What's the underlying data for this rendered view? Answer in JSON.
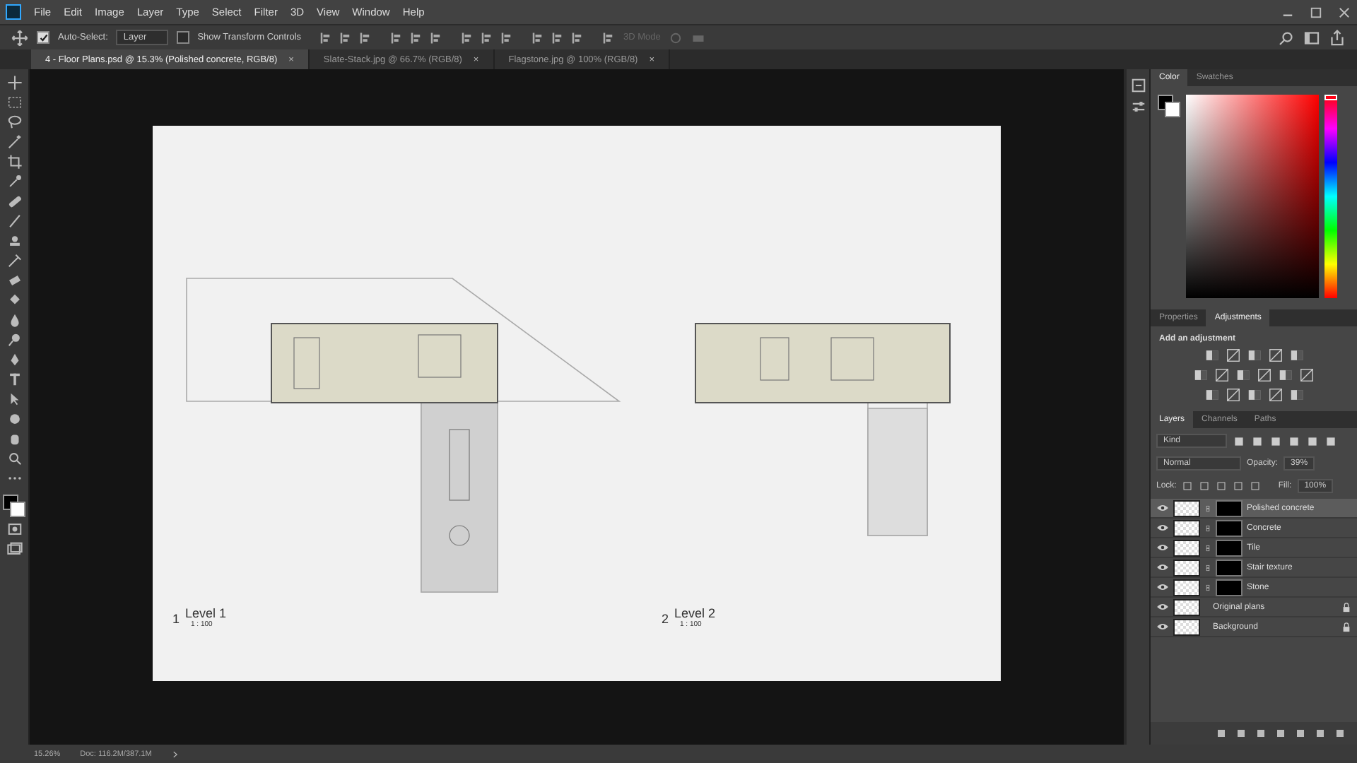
{
  "menu": [
    "File",
    "Edit",
    "Image",
    "Layer",
    "Type",
    "Select",
    "Filter",
    "3D",
    "View",
    "Window",
    "Help"
  ],
  "options_bar": {
    "auto_select": {
      "label": "Auto-Select:",
      "checked": true
    },
    "target": {
      "value": "Layer"
    },
    "transform_controls": {
      "label": "Show Transform Controls",
      "checked": false
    },
    "mode_3d": {
      "label": "3D Mode",
      "disabled": true
    }
  },
  "document_tabs": [
    {
      "label": "4 - Floor Plans.psd @ 15.3% (Polished concrete, RGB/8)",
      "close": "×",
      "selected": true
    },
    {
      "label": "Slate-Stack.jpg @ 66.7% (RGB/8)",
      "close": "×",
      "selected": false
    },
    {
      "label": "Flagstone.jpg @ 100% (RGB/8)",
      "close": "×",
      "selected": false
    }
  ],
  "canvas": {
    "plans": [
      {
        "number": "1",
        "title": "Level 1",
        "scale": "1 : 100"
      },
      {
        "number": "2",
        "title": "Level 2",
        "scale": "1 : 100"
      }
    ]
  },
  "color_panel": {
    "tabs": [
      {
        "label": "Color",
        "selected": true
      },
      {
        "label": "Swatches",
        "selected": false
      }
    ],
    "hue_slider": {
      "level": 1
    }
  },
  "adjustments_panel": {
    "tabs": [
      {
        "label": "Properties",
        "selected": false
      },
      {
        "label": "Adjustments",
        "selected": true
      }
    ],
    "heading": "Add an adjustment"
  },
  "layers_panel": {
    "tabs": [
      {
        "label": "Layers",
        "selected": true
      },
      {
        "label": "Channels",
        "selected": false
      },
      {
        "label": "Paths",
        "selected": false
      }
    ],
    "filter": "Kind",
    "blend_mode": "Normal",
    "opacity_label": "Opacity:",
    "opacity": "39%",
    "lock_label": "Lock:",
    "fill_label": "Fill:",
    "fill": "100%",
    "layers": [
      {
        "name": "Polished concrete",
        "visible": true,
        "selected": true,
        "mask": true,
        "locked": false
      },
      {
        "name": "Concrete",
        "visible": true,
        "selected": false,
        "mask": true,
        "locked": false
      },
      {
        "name": "Tile",
        "visible": true,
        "selected": false,
        "mask": true,
        "locked": false
      },
      {
        "name": "Stair texture",
        "visible": true,
        "selected": false,
        "mask": true,
        "locked": false
      },
      {
        "name": "Stone",
        "visible": true,
        "selected": false,
        "mask": true,
        "locked": false
      },
      {
        "name": "Original plans",
        "visible": true,
        "selected": false,
        "mask": false,
        "locked": true
      },
      {
        "name": "Background",
        "visible": true,
        "selected": false,
        "mask": false,
        "locked": true
      }
    ]
  },
  "status_bar": {
    "zoom": "15.26%",
    "doc": "Doc: 116.2M/387.1M"
  }
}
